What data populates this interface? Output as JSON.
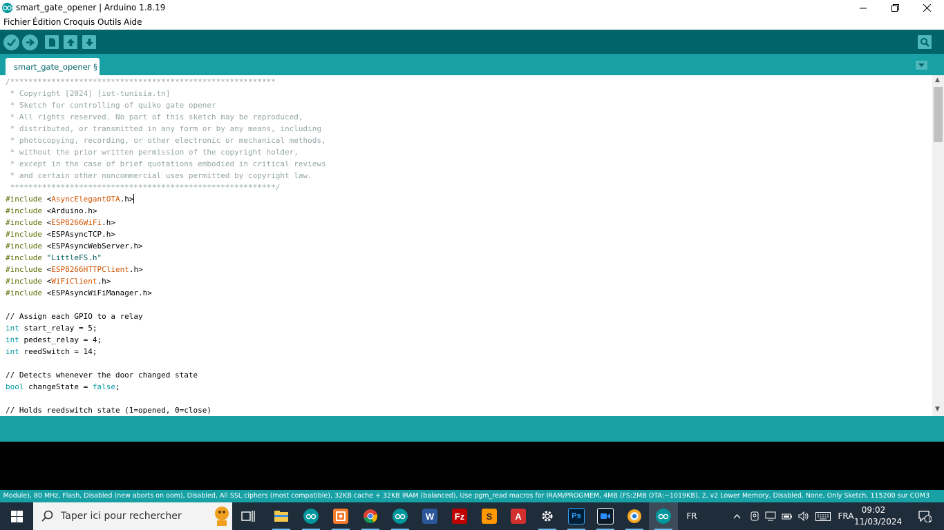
{
  "window": {
    "title": "smart_gate_opener | Arduino 1.8.19"
  },
  "menu": [
    "Fichier",
    "Édition",
    "Croquis",
    "Outils",
    "Aide"
  ],
  "tab": {
    "label": "smart_gate_opener §"
  },
  "code_lines": [
    {
      "parts": [
        {
          "t": "/**********************************************************",
          "c": "cm"
        }
      ]
    },
    {
      "parts": [
        {
          "t": " * Copyright [2024] [iot-tunisia.tn]",
          "c": "cm"
        }
      ]
    },
    {
      "parts": [
        {
          "t": " * Sketch for controlling of quiko gate opener",
          "c": "cm"
        }
      ]
    },
    {
      "parts": [
        {
          "t": " * All rights reserved. No part of this sketch may be reproduced,",
          "c": "cm"
        }
      ]
    },
    {
      "parts": [
        {
          "t": " * distributed, or transmitted in any form or by any means, including",
          "c": "cm"
        }
      ]
    },
    {
      "parts": [
        {
          "t": " * photocopying, recording, or other electronic or mechanical methods,",
          "c": "cm"
        }
      ]
    },
    {
      "parts": [
        {
          "t": " * without the prior written permission of the copyright holder,",
          "c": "cm"
        }
      ]
    },
    {
      "parts": [
        {
          "t": " * except in the case of brief quotations embodied in critical reviews",
          "c": "cm"
        }
      ]
    },
    {
      "parts": [
        {
          "t": " * and certain other noncommercial uses permitted by copyright law.",
          "c": "cm"
        }
      ]
    },
    {
      "parts": [
        {
          "t": " **********************************************************/",
          "c": "cm"
        }
      ]
    },
    {
      "caret": true,
      "parts": [
        {
          "t": "#include ",
          "c": "pp"
        },
        {
          "t": "<",
          "c": ""
        },
        {
          "t": "AsyncElegantOTA",
          "c": "lib"
        },
        {
          "t": ".h>",
          "c": ""
        }
      ]
    },
    {
      "parts": [
        {
          "t": "#include ",
          "c": "pp"
        },
        {
          "t": "<Arduino.h>",
          "c": ""
        }
      ]
    },
    {
      "parts": [
        {
          "t": "#include ",
          "c": "pp"
        },
        {
          "t": "<",
          "c": ""
        },
        {
          "t": "ESP8266WiFi",
          "c": "lib"
        },
        {
          "t": ".h>",
          "c": ""
        }
      ]
    },
    {
      "parts": [
        {
          "t": "#include ",
          "c": "pp"
        },
        {
          "t": "<ESPAsyncTCP.h>",
          "c": ""
        }
      ]
    },
    {
      "parts": [
        {
          "t": "#include ",
          "c": "pp"
        },
        {
          "t": "<ESPAsyncWebServer.h>",
          "c": ""
        }
      ]
    },
    {
      "parts": [
        {
          "t": "#include ",
          "c": "pp"
        },
        {
          "t": "\"LittleFS.h\"",
          "c": "str"
        }
      ]
    },
    {
      "parts": [
        {
          "t": "#include ",
          "c": "pp"
        },
        {
          "t": "<",
          "c": ""
        },
        {
          "t": "ESP8266HTTPClient",
          "c": "lib"
        },
        {
          "t": ".h>",
          "c": ""
        }
      ]
    },
    {
      "parts": [
        {
          "t": "#include ",
          "c": "pp"
        },
        {
          "t": "<",
          "c": ""
        },
        {
          "t": "WiFiClient",
          "c": "lib"
        },
        {
          "t": ".h>",
          "c": ""
        }
      ]
    },
    {
      "parts": [
        {
          "t": "#include ",
          "c": "pp"
        },
        {
          "t": "<ESPAsyncWiFiManager.h>",
          "c": ""
        }
      ]
    },
    {
      "parts": []
    },
    {
      "parts": [
        {
          "t": "// Assign each GPIO to a relay",
          "c": ""
        }
      ]
    },
    {
      "parts": [
        {
          "t": "int",
          "c": "kw"
        },
        {
          "t": " start_relay = 5;",
          "c": ""
        }
      ]
    },
    {
      "parts": [
        {
          "t": "int",
          "c": "kw"
        },
        {
          "t": " pedest_relay = 4;",
          "c": ""
        }
      ]
    },
    {
      "parts": [
        {
          "t": "int",
          "c": "kw"
        },
        {
          "t": " reedSwitch = 14;",
          "c": ""
        }
      ]
    },
    {
      "parts": []
    },
    {
      "parts": [
        {
          "t": "// Detects whenever the door changed state",
          "c": ""
        }
      ]
    },
    {
      "parts": [
        {
          "t": "bool",
          "c": "kw"
        },
        {
          "t": " changeState = ",
          "c": ""
        },
        {
          "t": "false",
          "c": "kw"
        },
        {
          "t": ";",
          "c": ""
        }
      ]
    },
    {
      "parts": []
    },
    {
      "parts": [
        {
          "t": "// Holds reedswitch state (1=opened, 0=close)",
          "c": ""
        }
      ]
    }
  ],
  "footer": {
    "board_info": "Module), 80 MHz, Flash, Disabled (new aborts on oom), Disabled, All SSL ciphers (most compatible), 32KB cache + 32KB IRAM (balanced), Use pgm_read macros for IRAM/PROGMEM, 4MB (FS:2MB OTA:~1019KB), 2, v2 Lower Memory, Disabled, None, Only Sketch, 115200 sur COM3"
  },
  "taskbar": {
    "search_placeholder": "Taper ici pour rechercher",
    "language": "FR",
    "keyboard": "FRA",
    "time": "09:02",
    "date": "11/03/2024",
    "notification_count": "1",
    "apps": [
      {
        "name": "task-view-icon"
      },
      {
        "name": "file-explorer-icon",
        "color": "#f2c94c"
      },
      {
        "name": "arduino-ide-icon",
        "color": "#00979c"
      },
      {
        "name": "gitkraken-icon",
        "color": "#f57c2b"
      },
      {
        "name": "chrome-icon"
      },
      {
        "name": "arduino-ide-2-icon",
        "color": "#00979c"
      },
      {
        "name": "word-icon",
        "color": "#2b579a",
        "glyph": "W"
      },
      {
        "name": "filezilla-icon",
        "color": "#bf0000",
        "glyph": "Fz"
      },
      {
        "name": "sublime-text-icon",
        "color": "#ff9800",
        "glyph": "S"
      },
      {
        "name": "acrobat-icon",
        "color": "#d32f2f",
        "glyph": "A"
      },
      {
        "name": "settings-icon",
        "color": "#ffffff"
      },
      {
        "name": "photoshop-icon",
        "color": "#001e36",
        "glyph": "Ps"
      },
      {
        "name": "zoom-icon",
        "color": "#2d8cff"
      },
      {
        "name": "image-viewer-icon",
        "color": "#e8eef4"
      },
      {
        "name": "arduino-active-icon",
        "color": "#00979c"
      }
    ]
  },
  "colors": {
    "toolbar": "#006468",
    "tabbar": "#17a1a5",
    "button": "#4db7bb",
    "taskbar": "#1f2d3a"
  }
}
